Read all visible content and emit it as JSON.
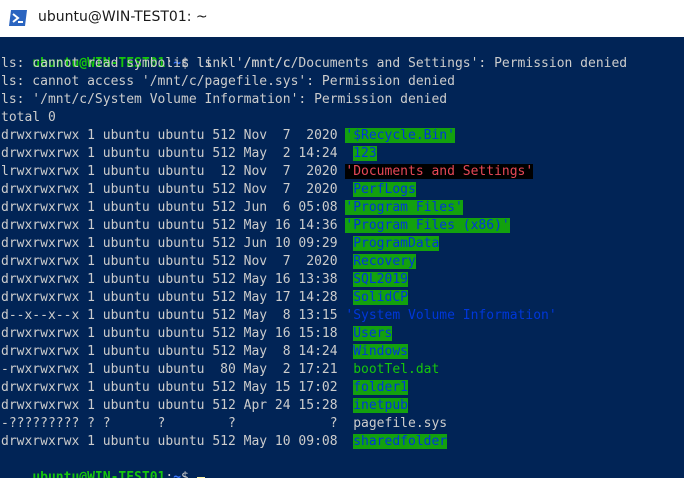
{
  "window": {
    "title": "ubuntu@WIN-TEST01: ~",
    "icon": "powershell-terminal-icon"
  },
  "colors": {
    "terminal_bg": "#012456",
    "text": "#cccccc",
    "prompt_user": "#16c60c",
    "prompt_path": "#3b78ff",
    "ow_dir_bg": "#13a10e",
    "ow_dir_fg": "#0037da",
    "broken_link_fg": "#e74856",
    "cursor": "#f9f1a5"
  },
  "terminal": {
    "command": {
      "user": "ubuntu@WIN-TEST01",
      "sep": ":",
      "cwd": "~",
      "dollar": "$ ",
      "text": "ls -l /mnt/c"
    },
    "errors": [
      "ls: cannot read symbolic link '/mnt/c/Documents and Settings': Permission denied",
      "ls: cannot access '/mnt/c/pagefile.sys': Permission denied",
      "ls: '/mnt/c/System Volume Information': Permission denied"
    ],
    "total": "total 0",
    "entries": [
      {
        "meta": "drwxrwxrwx 1 ubuntu ubuntu 512 Nov  7  2020 ",
        "name": "'$Recycle.Bin'",
        "style": "ow"
      },
      {
        "meta": "drwxrwxrwx 1 ubuntu ubuntu 512 May  2 14:24  ",
        "name": "123",
        "style": "ow"
      },
      {
        "meta": "lrwxrwxrwx 1 ubuntu ubuntu  12 Nov  7  2020 ",
        "name": "'Documents and Settings'",
        "style": "lnk"
      },
      {
        "meta": "drwxrwxrwx 1 ubuntu ubuntu 512 Nov  7  2020  ",
        "name": "PerfLogs",
        "style": "ow"
      },
      {
        "meta": "drwxrwxrwx 1 ubuntu ubuntu 512 Jun  6 05:08 ",
        "name": "'Program Files'",
        "style": "ow"
      },
      {
        "meta": "drwxrwxrwx 1 ubuntu ubuntu 512 May 16 14:36 ",
        "name": "'Program Files (x86)'",
        "style": "ow"
      },
      {
        "meta": "drwxrwxrwx 1 ubuntu ubuntu 512 Jun 10 09:29  ",
        "name": "ProgramData",
        "style": "ow"
      },
      {
        "meta": "drwxrwxrwx 1 ubuntu ubuntu 512 Nov  7  2020  ",
        "name": "Recovery",
        "style": "ow"
      },
      {
        "meta": "drwxrwxrwx 1 ubuntu ubuntu 512 May 16 13:38  ",
        "name": "SQL2019",
        "style": "ow"
      },
      {
        "meta": "drwxrwxrwx 1 ubuntu ubuntu 512 May 17 14:28  ",
        "name": "SolidCP",
        "style": "ow"
      },
      {
        "meta": "d--x--x--x 1 ubuntu ubuntu 512 May  8 13:15 ",
        "name": "'System Volume Information'",
        "style": "sys"
      },
      {
        "meta": "drwxrwxrwx 1 ubuntu ubuntu 512 May 16 15:18  ",
        "name": "Users",
        "style": "ow"
      },
      {
        "meta": "drwxrwxrwx 1 ubuntu ubuntu 512 May  8 14:24  ",
        "name": "Windows",
        "style": "ow"
      },
      {
        "meta": "-rwxrwxrwx 1 ubuntu ubuntu  80 May  2 17:21  ",
        "name": "bootTel.dat",
        "style": "file"
      },
      {
        "meta": "drwxrwxrwx 1 ubuntu ubuntu 512 May 15 17:02  ",
        "name": "folder1",
        "style": "ow"
      },
      {
        "meta": "drwxrwxrwx 1 ubuntu ubuntu 512 Apr 24 15:28  ",
        "name": "inetpub",
        "style": "ow"
      },
      {
        "meta": "-????????? ? ?      ?        ?            ?  ",
        "name": "pagefile.sys",
        "style": "plain"
      },
      {
        "meta": "drwxrwxrwx 1 ubuntu ubuntu 512 May 10 09:08  ",
        "name": "sharedfolder",
        "style": "ow"
      }
    ],
    "final_prompt": {
      "user": "ubuntu@WIN-TEST01",
      "sep": ":",
      "cwd": "~",
      "dollar": "$ "
    }
  }
}
